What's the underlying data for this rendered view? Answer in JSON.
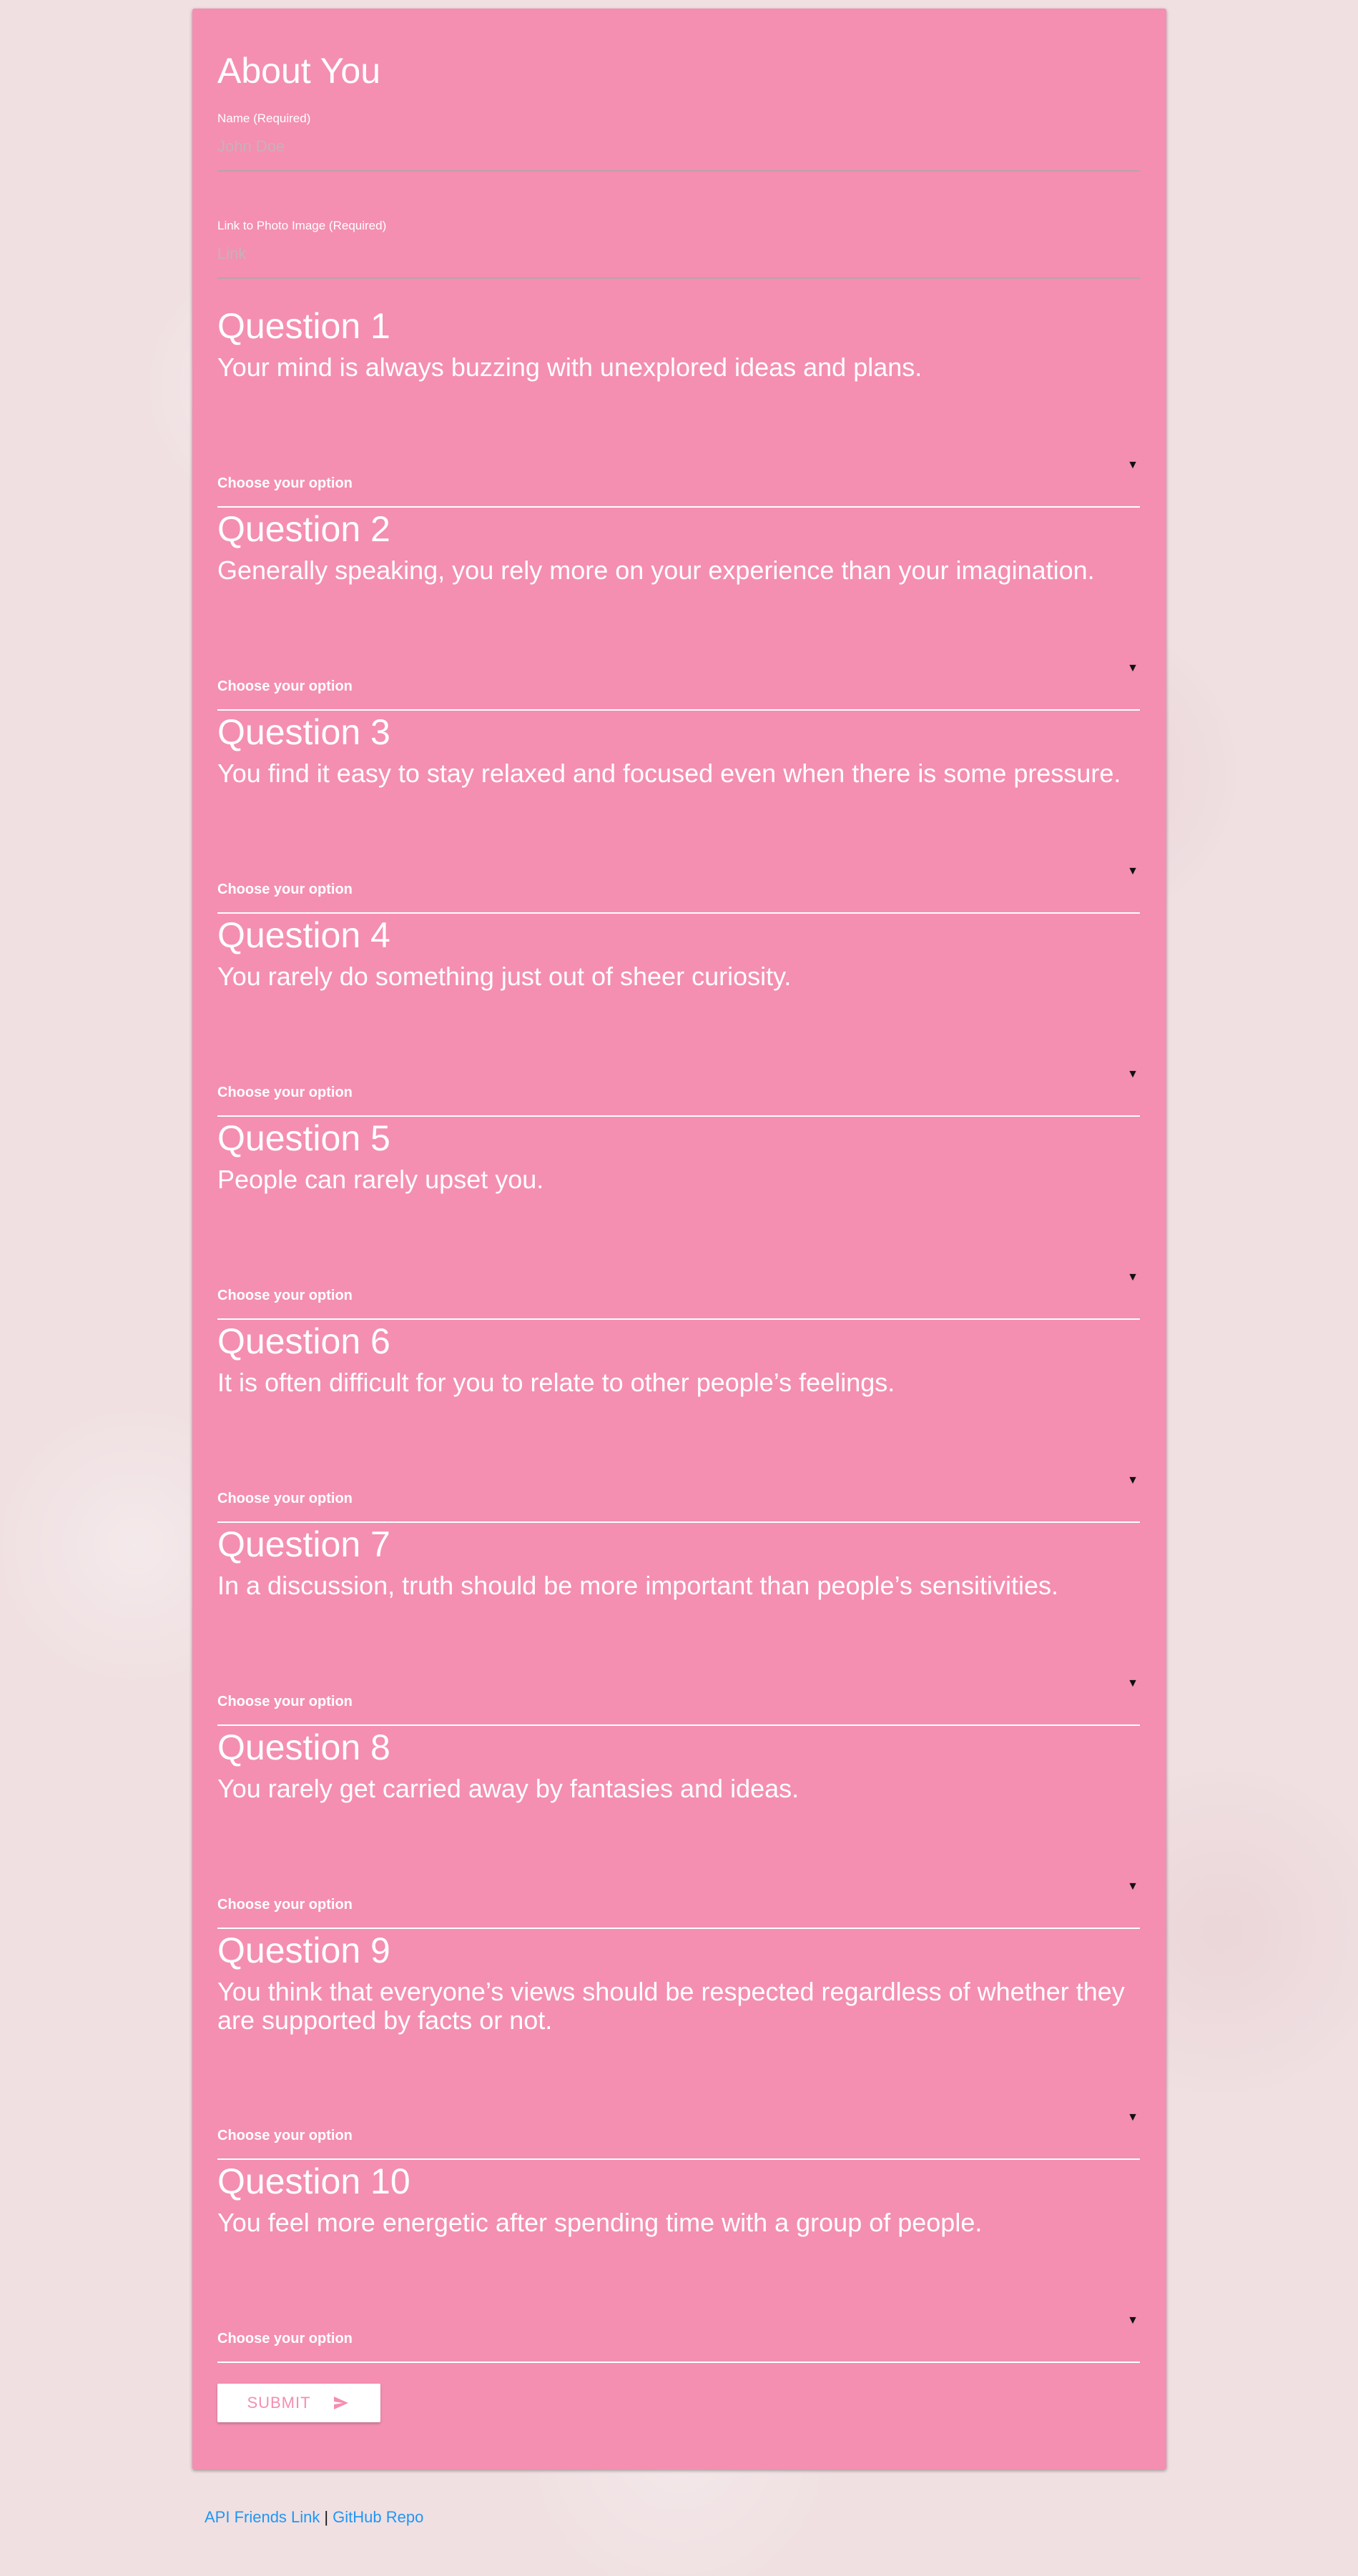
{
  "form": {
    "about_title": "About You",
    "name": {
      "label": "Name (Required)",
      "placeholder": "John Doe",
      "value": ""
    },
    "photo": {
      "label": "Link to Photo Image (Required)",
      "placeholder": "Link",
      "value": ""
    },
    "questions": [
      {
        "title": "Question 1",
        "text": "Your mind is always buzzing with unexplored ideas and plans.",
        "selected": "Choose your option"
      },
      {
        "title": "Question 2",
        "text": "Generally speaking, you rely more on your experience than your imagination.",
        "selected": "Choose your option"
      },
      {
        "title": "Question 3",
        "text": "You find it easy to stay relaxed and focused even when there is some pressure.",
        "selected": "Choose your option"
      },
      {
        "title": "Question 4",
        "text": "You rarely do something just out of sheer curiosity.",
        "selected": "Choose your option"
      },
      {
        "title": "Question 5",
        "text": "People can rarely upset you.",
        "selected": "Choose your option"
      },
      {
        "title": "Question 6",
        "text": "It is often difficult for you to relate to other people’s feelings.",
        "selected": "Choose your option"
      },
      {
        "title": "Question 7",
        "text": "In a discussion, truth should be more important than people’s sensitivities.",
        "selected": "Choose your option"
      },
      {
        "title": "Question 8",
        "text": "You rarely get carried away by fantasies and ideas.",
        "selected": "Choose your option"
      },
      {
        "title": "Question 9",
        "text": "You think that everyone’s views should be respected regardless of whether they are supported by facts or not.",
        "selected": "Choose your option"
      },
      {
        "title": "Question 10",
        "text": "You feel more energetic after spending time with a group of people.",
        "selected": "Choose your option"
      }
    ],
    "submit_label": "SUBMIT",
    "submit_icon": "send-icon"
  },
  "footer": {
    "api_link": "API Friends Link",
    "separator": "|",
    "github_link": "GitHub Repo"
  },
  "colors": {
    "card": "#f48fb1",
    "page_background": "#f0e0e2",
    "link": "#2196f3"
  }
}
